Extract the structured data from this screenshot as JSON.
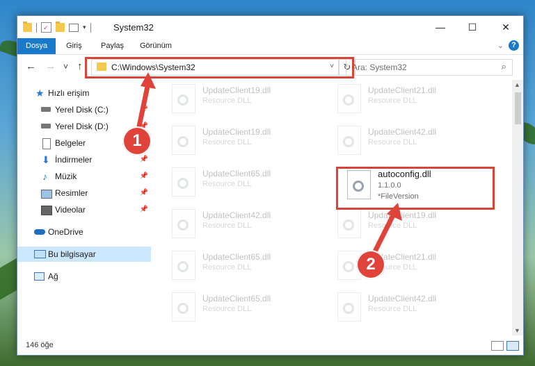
{
  "window": {
    "title": "System32",
    "minimize_glyph": "—",
    "maximize_glyph": "☐",
    "close_glyph": "✕"
  },
  "ribbon": {
    "tabs": [
      "Dosya",
      "Giriş",
      "Paylaş",
      "Görünüm"
    ]
  },
  "nav": {
    "back_glyph": "←",
    "forward_glyph": "→",
    "recent_glyph": "˅",
    "up_glyph": "↑"
  },
  "address": {
    "path": "C:\\Windows\\System32",
    "dropdown_glyph": "˅",
    "refresh_glyph": "↻"
  },
  "search": {
    "placeholder": "Ara: System32",
    "icon": "search-icon"
  },
  "sidebar": {
    "items": [
      {
        "label": "Hızlı erişim",
        "icon": "star-icon"
      },
      {
        "label": "Yerel Disk (C:)",
        "icon": "disk-icon"
      },
      {
        "label": "Yerel Disk (D:)",
        "icon": "disk-icon"
      },
      {
        "label": "Belgeler",
        "icon": "document-icon"
      },
      {
        "label": "İndirmeler",
        "icon": "download-icon"
      },
      {
        "label": "Müzik",
        "icon": "music-icon"
      },
      {
        "label": "Resimler",
        "icon": "picture-icon"
      },
      {
        "label": "Videolar",
        "icon": "video-icon"
      },
      {
        "label": "OneDrive",
        "icon": "cloud-icon"
      },
      {
        "label": "Bu bilgisayar",
        "icon": "computer-icon"
      },
      {
        "label": "Ağ",
        "icon": "network-icon"
      }
    ]
  },
  "files": {
    "ghost": [
      {
        "name": "UpdateClient19.dll",
        "type": "Resource DLL"
      },
      {
        "name": "UpdateClient21.dll",
        "type": "Resource DLL"
      },
      {
        "name": "UpdateClient19.dll",
        "type": "Resource DLL"
      },
      {
        "name": "UpdateClient42.dll",
        "type": "Resource DLL"
      },
      {
        "name": "UpdateClient65.dll",
        "type": "Resource DLL"
      },
      {
        "name": "UpdateClient42.dll",
        "type": "Resource DLL"
      },
      {
        "name": "UpdateClient19.dll",
        "type": "Resource DLL"
      },
      {
        "name": "UpdateClient65.dll",
        "type": "Resource DLL"
      },
      {
        "name": "UpdateClient21.dll",
        "type": "Resource DLL"
      },
      {
        "name": "UpdateClient65.dll",
        "type": "Resource DLL"
      },
      {
        "name": "UpdateClient42.dll",
        "type": "Resource DLL"
      }
    ],
    "highlighted": {
      "name": "autoconfig.dll",
      "version": "1.1.0.0",
      "meta": "*FileVersion"
    }
  },
  "status": {
    "count": "146 öğe"
  },
  "annotations": {
    "step1": "1",
    "step2": "2",
    "color": "#e0433a"
  }
}
